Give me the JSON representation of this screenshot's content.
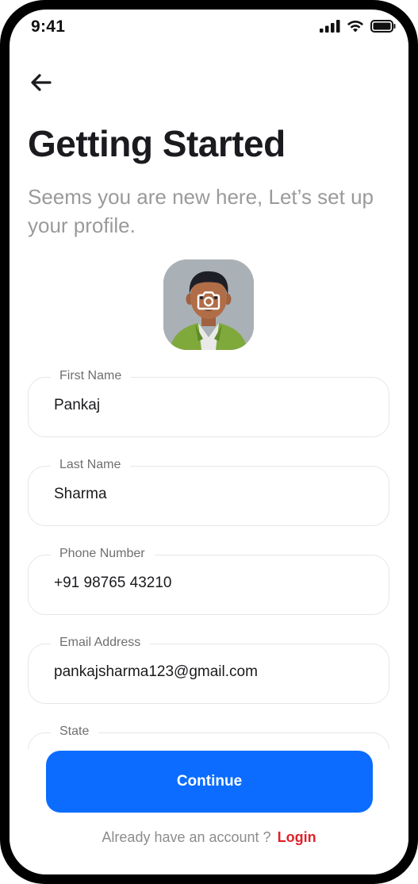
{
  "status_bar": {
    "time": "9:41",
    "icons": [
      "signal-icon",
      "wifi-icon",
      "battery-icon"
    ]
  },
  "header": {
    "back_icon": "arrow-left-icon",
    "title": "Getting Started",
    "subtitle": "Seems you are new here, Let’s set up your profile."
  },
  "avatar": {
    "overlay_icon": "camera-icon"
  },
  "form": {
    "fields": [
      {
        "label": "First Name",
        "value": "Pankaj"
      },
      {
        "label": "Last Name",
        "value": "Sharma"
      },
      {
        "label": "Phone Number",
        "value": "+91 98765 43210"
      },
      {
        "label": "Email Address",
        "value": "pankajsharma123@gmail.com"
      },
      {
        "label": "State",
        "value": ""
      }
    ]
  },
  "footer": {
    "continue_label": "Continue",
    "prompt": "Already have an account ?",
    "login_label": "Login"
  },
  "colors": {
    "primary": "#0b6cff",
    "link": "#e0202a",
    "title": "#1b1b1f",
    "subtitle": "#9a9a9a"
  }
}
